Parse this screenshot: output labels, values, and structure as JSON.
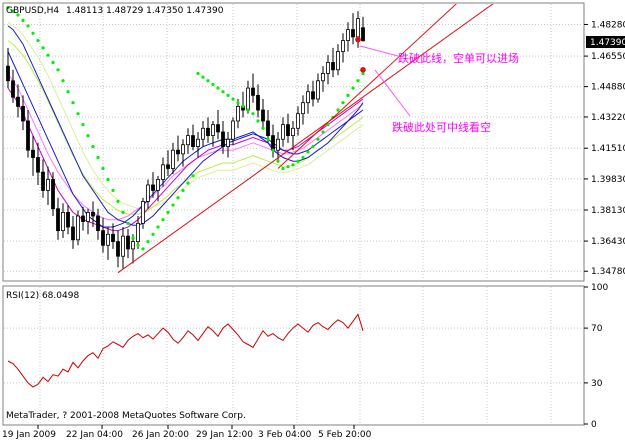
{
  "header": {
    "symbol": "GBPUSD,H4",
    "ohlc": "1.48113 1.48729 1.47350 1.47390",
    "current_price": "1.47390"
  },
  "annotations": {
    "upper": "跌破此线，空单可以进场",
    "lower": "跌破此处可中线看空"
  },
  "rsi_panel": {
    "label": "RSI(12) 68.0498",
    "copyright": "MetaTrader, ? 2001-2008 MetaQuotes Software Corp."
  },
  "colors": {
    "bull": "#000000",
    "bear": "#000000",
    "sar": "#00ee00",
    "ma_blue": "#1a1acc",
    "ma_magenta": "#cc00cc",
    "ma_pink": "#ff77ff",
    "ma_lime": "#bbee44",
    "ma_yellowgreen": "#ddee99",
    "trendline": "#dd1111",
    "annotation_text": "#ff00ff",
    "rsi": "#cc0000",
    "grid": "#c8c8c8",
    "border": "#808080"
  },
  "chart_data": [
    {
      "type": "candlestick",
      "title": "GBPUSD,H4",
      "price_ticks": [
        "1.48280",
        "1.46550",
        "1.44880",
        "1.43220",
        "1.41510",
        "1.39830",
        "1.38130",
        "1.36430",
        "1.34780"
      ],
      "ylim": [
        1.343,
        1.494
      ],
      "time_labels": [
        "19 Jan 2009",
        "22 Jan 04:00",
        "26 Jan 20:00",
        "29 Jan 12:00",
        "3 Feb 04:00",
        "5 Feb 20:00"
      ],
      "candles": [
        [
          1.46,
          1.47,
          1.448,
          1.452
        ],
        [
          1.452,
          1.458,
          1.44,
          1.443
        ],
        [
          1.443,
          1.45,
          1.432,
          1.438
        ],
        [
          1.438,
          1.444,
          1.425,
          1.43
        ],
        [
          1.43,
          1.436,
          1.41,
          1.414
        ],
        [
          1.414,
          1.422,
          1.4,
          1.41
        ],
        [
          1.41,
          1.418,
          1.395,
          1.402
        ],
        [
          1.402,
          1.409,
          1.388,
          1.392
        ],
        [
          1.392,
          1.405,
          1.384,
          1.398
        ],
        [
          1.398,
          1.402,
          1.378,
          1.382
        ],
        [
          1.382,
          1.388,
          1.365,
          1.37
        ],
        [
          1.37,
          1.385,
          1.366,
          1.38
        ],
        [
          1.38,
          1.384,
          1.368,
          1.372
        ],
        [
          1.372,
          1.378,
          1.36,
          1.365
        ],
        [
          1.365,
          1.381,
          1.362,
          1.378
        ],
        [
          1.378,
          1.383,
          1.37,
          1.375
        ],
        [
          1.375,
          1.382,
          1.368,
          1.38
        ],
        [
          1.38,
          1.386,
          1.372,
          1.378
        ],
        [
          1.378,
          1.382,
          1.365,
          1.37
        ],
        [
          1.37,
          1.377,
          1.358,
          1.362
        ],
        [
          1.362,
          1.372,
          1.354,
          1.368
        ],
        [
          1.368,
          1.374,
          1.36,
          1.364
        ],
        [
          1.364,
          1.37,
          1.35,
          1.356
        ],
        [
          1.356,
          1.372,
          1.349,
          1.367
        ],
        [
          1.367,
          1.371,
          1.355,
          1.36
        ],
        [
          1.36,
          1.368,
          1.352,
          1.364
        ],
        [
          1.364,
          1.378,
          1.36,
          1.374
        ],
        [
          1.374,
          1.388,
          1.371,
          1.386
        ],
        [
          1.386,
          1.398,
          1.382,
          1.395
        ],
        [
          1.395,
          1.402,
          1.388,
          1.392
        ],
        [
          1.392,
          1.4,
          1.386,
          1.398
        ],
        [
          1.398,
          1.41,
          1.394,
          1.406
        ],
        [
          1.406,
          1.414,
          1.4,
          1.404
        ],
        [
          1.404,
          1.418,
          1.401,
          1.414
        ],
        [
          1.414,
          1.422,
          1.408,
          1.412
        ],
        [
          1.412,
          1.42,
          1.405,
          1.417
        ],
        [
          1.417,
          1.426,
          1.412,
          1.422
        ],
        [
          1.422,
          1.428,
          1.414,
          1.416
        ],
        [
          1.416,
          1.424,
          1.41,
          1.42
        ],
        [
          1.42,
          1.43,
          1.416,
          1.426
        ],
        [
          1.426,
          1.432,
          1.418,
          1.422
        ],
        [
          1.422,
          1.43,
          1.416,
          1.428
        ],
        [
          1.428,
          1.436,
          1.42,
          1.424
        ],
        [
          1.424,
          1.43,
          1.412,
          1.416
        ],
        [
          1.416,
          1.424,
          1.41,
          1.42
        ],
        [
          1.42,
          1.432,
          1.417,
          1.43
        ],
        [
          1.43,
          1.442,
          1.426,
          1.438
        ],
        [
          1.438,
          1.446,
          1.432,
          1.436
        ],
        [
          1.436,
          1.452,
          1.434,
          1.448
        ],
        [
          1.448,
          1.456,
          1.44,
          1.444
        ],
        [
          1.444,
          1.45,
          1.432,
          1.436
        ],
        [
          1.436,
          1.442,
          1.426,
          1.43
        ],
        [
          1.43,
          1.436,
          1.418,
          1.422
        ],
        [
          1.422,
          1.428,
          1.41,
          1.414
        ],
        [
          1.414,
          1.424,
          1.408,
          1.42
        ],
        [
          1.42,
          1.432,
          1.416,
          1.428
        ],
        [
          1.428,
          1.434,
          1.418,
          1.422
        ],
        [
          1.422,
          1.43,
          1.414,
          1.426
        ],
        [
          1.426,
          1.438,
          1.422,
          1.434
        ],
        [
          1.434,
          1.444,
          1.428,
          1.44
        ],
        [
          1.44,
          1.45,
          1.434,
          1.446
        ],
        [
          1.446,
          1.452,
          1.438,
          1.442
        ],
        [
          1.442,
          1.456,
          1.44,
          1.452
        ],
        [
          1.452,
          1.46,
          1.446,
          1.456
        ],
        [
          1.456,
          1.466,
          1.45,
          1.462
        ],
        [
          1.462,
          1.47,
          1.454,
          1.458
        ],
        [
          1.458,
          1.472,
          1.455,
          1.468
        ],
        [
          1.468,
          1.478,
          1.462,
          1.474
        ],
        [
          1.474,
          1.484,
          1.468,
          1.48
        ],
        [
          1.48,
          1.489,
          1.472,
          1.476
        ],
        [
          1.476,
          1.49,
          1.47,
          1.486
        ],
        [
          1.481,
          1.487,
          1.4735,
          1.4739
        ]
      ],
      "sar": [
        1.492,
        1.49,
        1.488,
        1.485,
        1.482,
        1.478,
        1.474,
        1.47,
        1.466,
        1.462,
        1.458,
        1.452,
        1.446,
        1.44,
        1.434,
        1.428,
        1.422,
        1.416,
        1.41,
        1.404,
        1.398,
        1.392,
        1.386,
        1.38,
        1.374,
        1.366,
        1.362,
        1.36,
        1.364,
        1.368,
        1.372,
        1.376,
        1.38,
        1.384,
        1.388,
        1.392,
        1.396,
        1.4,
        1.456,
        1.454,
        1.452,
        1.45,
        1.448,
        1.446,
        1.444,
        1.442,
        1.44,
        1.438,
        1.436,
        1.434,
        1.43,
        1.426,
        1.42,
        1.414,
        1.408,
        1.404,
        1.405,
        1.406,
        1.408,
        1.41,
        1.413,
        1.416,
        1.42,
        1.424,
        1.428,
        1.432,
        1.436,
        1.44,
        1.444,
        1.448,
        1.452,
        1.456
      ],
      "ma_blue": [
        1.468,
        1.462,
        1.456,
        1.45,
        1.444,
        1.438,
        1.432,
        1.426,
        1.42,
        1.414,
        1.408,
        1.402,
        1.396,
        1.39,
        1.386,
        1.382,
        1.378,
        1.376,
        1.374,
        1.372,
        1.372,
        1.372,
        1.373,
        1.374,
        1.376,
        1.378,
        1.381,
        1.384,
        1.387,
        1.39,
        1.393,
        1.396,
        1.399,
        1.402,
        1.405,
        1.408,
        1.41,
        1.412,
        1.414,
        1.416,
        1.417,
        1.418,
        1.419,
        1.42,
        1.42,
        1.42,
        1.421,
        1.422,
        1.423,
        1.424,
        1.422,
        1.42,
        1.418,
        1.414,
        1.412,
        1.41,
        1.409,
        1.408,
        1.408,
        1.409,
        1.41,
        1.412,
        1.414,
        1.416,
        1.418,
        1.421,
        1.424,
        1.427,
        1.43,
        1.433,
        1.436,
        1.44
      ],
      "ma_blue2": [
        1.482,
        1.48,
        1.476,
        1.472,
        1.466,
        1.46,
        1.454,
        1.448,
        1.442,
        1.436,
        1.43,
        1.424,
        1.418,
        1.412,
        1.406,
        1.4,
        1.396,
        1.392,
        1.388,
        1.384,
        1.38,
        1.378,
        1.376,
        1.375,
        1.374,
        1.373,
        1.373,
        1.374,
        1.376,
        1.378,
        1.381,
        1.384,
        1.387,
        1.39,
        1.393,
        1.396,
        1.399,
        1.402,
        1.405,
        1.408,
        1.41,
        1.412,
        1.414,
        1.416,
        1.418,
        1.419,
        1.42,
        1.421,
        1.422,
        1.423,
        1.422,
        1.421,
        1.42,
        1.418,
        1.416,
        1.414,
        1.413,
        1.412,
        1.412,
        1.413,
        1.414,
        1.416,
        1.418,
        1.42,
        1.422,
        1.424,
        1.426,
        1.428,
        1.43,
        1.432,
        1.434,
        1.436
      ],
      "ma_magenta": [
        1.448,
        1.444,
        1.44,
        1.434,
        1.428,
        1.422,
        1.416,
        1.41,
        1.404,
        1.398,
        1.392,
        1.388,
        1.384,
        1.38,
        1.378,
        1.376,
        1.375,
        1.374,
        1.373,
        1.372,
        1.371,
        1.37,
        1.37,
        1.371,
        1.372,
        1.374,
        1.376,
        1.379,
        1.382,
        1.385,
        1.388,
        1.391,
        1.394,
        1.397,
        1.4,
        1.403,
        1.406,
        1.408,
        1.41,
        1.412,
        1.414,
        1.415,
        1.416,
        1.417,
        1.417,
        1.417,
        1.418,
        1.419,
        1.42,
        1.421,
        1.42,
        1.419,
        1.418,
        1.416,
        1.415,
        1.414,
        1.414,
        1.415,
        1.416,
        1.418,
        1.42,
        1.422,
        1.424,
        1.426,
        1.428,
        1.43,
        1.432,
        1.434,
        1.436,
        1.438,
        1.44,
        1.442
      ],
      "ma_pink": [
        1.456,
        1.452,
        1.448,
        1.442,
        1.436,
        1.43,
        1.424,
        1.418,
        1.412,
        1.407,
        1.402,
        1.398,
        1.394,
        1.39,
        1.387,
        1.384,
        1.382,
        1.38,
        1.378,
        1.377,
        1.376,
        1.376,
        1.376,
        1.377,
        1.378,
        1.38,
        1.382,
        1.384,
        1.386,
        1.389,
        1.392,
        1.394,
        1.397,
        1.4,
        1.402,
        1.404,
        1.406,
        1.408,
        1.41,
        1.411,
        1.412,
        1.413,
        1.414,
        1.414,
        1.414,
        1.414,
        1.415,
        1.416,
        1.417,
        1.418,
        1.417,
        1.416,
        1.415,
        1.414,
        1.413,
        1.412,
        1.412,
        1.413,
        1.414,
        1.415,
        1.417,
        1.419,
        1.421,
        1.423,
        1.425,
        1.427,
        1.429,
        1.431,
        1.433,
        1.435,
        1.437,
        1.439
      ],
      "ma_lime": [
        1.474,
        1.472,
        1.469,
        1.466,
        1.462,
        1.457,
        1.452,
        1.447,
        1.441,
        1.435,
        1.429,
        1.423,
        1.417,
        1.411,
        1.406,
        1.401,
        1.397,
        1.393,
        1.39,
        1.387,
        1.385,
        1.383,
        1.381,
        1.38,
        1.379,
        1.379,
        1.379,
        1.38,
        1.381,
        1.383,
        1.385,
        1.387,
        1.389,
        1.392,
        1.394,
        1.396,
        1.398,
        1.4,
        1.402,
        1.403,
        1.404,
        1.405,
        1.406,
        1.407,
        1.407,
        1.407,
        1.408,
        1.409,
        1.41,
        1.411,
        1.41,
        1.409,
        1.408,
        1.407,
        1.406,
        1.405,
        1.405,
        1.406,
        1.407,
        1.408,
        1.41,
        1.412,
        1.414,
        1.416,
        1.418,
        1.42,
        1.422,
        1.424,
        1.426,
        1.428,
        1.43,
        1.432
      ],
      "ma_yellowgreen": [
        1.484,
        1.482,
        1.48,
        1.477,
        1.473,
        1.469,
        1.465,
        1.46,
        1.455,
        1.449,
        1.443,
        1.437,
        1.431,
        1.425,
        1.419,
        1.413,
        1.408,
        1.403,
        1.399,
        1.395,
        1.392,
        1.389,
        1.387,
        1.385,
        1.384,
        1.383,
        1.382,
        1.382,
        1.382,
        1.383,
        1.384,
        1.385,
        1.387,
        1.389,
        1.391,
        1.393,
        1.395,
        1.397,
        1.399,
        1.4,
        1.401,
        1.402,
        1.403,
        1.403,
        1.403,
        1.403,
        1.404,
        1.405,
        1.406,
        1.407,
        1.406,
        1.405,
        1.404,
        1.403,
        1.402,
        1.402,
        1.402,
        1.403,
        1.404,
        1.405,
        1.406,
        1.408,
        1.41,
        1.412,
        1.414,
        1.416,
        1.418,
        1.42,
        1.422,
        1.424,
        1.426,
        1.428
      ],
      "trendlines": [
        {
          "name": "lower-support",
          "from": [
            22,
            1.347
          ],
          "to": [
            100,
            1.5
          ]
        },
        {
          "name": "upper-support",
          "from": [
            54,
            1.404
          ],
          "to": [
            92,
            1.5
          ]
        }
      ],
      "markers": [
        {
          "name": "break-point-upper",
          "x": 70,
          "y": 1.4745
        },
        {
          "name": "break-point-lower",
          "x": 71,
          "y": 1.458
        }
      ]
    },
    {
      "type": "line",
      "title": "RSI(12) 68.0498",
      "y_ticks": [
        "100",
        "70",
        "30",
        "0"
      ],
      "ylim": [
        0,
        100
      ],
      "values": [
        46,
        44,
        40,
        35,
        30,
        27,
        29,
        34,
        31,
        36,
        35,
        40,
        38,
        45,
        41,
        46,
        50,
        52,
        48,
        55,
        57,
        60,
        58,
        56,
        61,
        64,
        66,
        63,
        65,
        62,
        66,
        70,
        67,
        62,
        59,
        63,
        68,
        65,
        61,
        66,
        71,
        68,
        64,
        70,
        73,
        69,
        65,
        60,
        58,
        56,
        62,
        68,
        64,
        66,
        63,
        61,
        66,
        70,
        73,
        70,
        67,
        72,
        74,
        71,
        69,
        73,
        76,
        74,
        70,
        75,
        80,
        68
      ]
    }
  ]
}
